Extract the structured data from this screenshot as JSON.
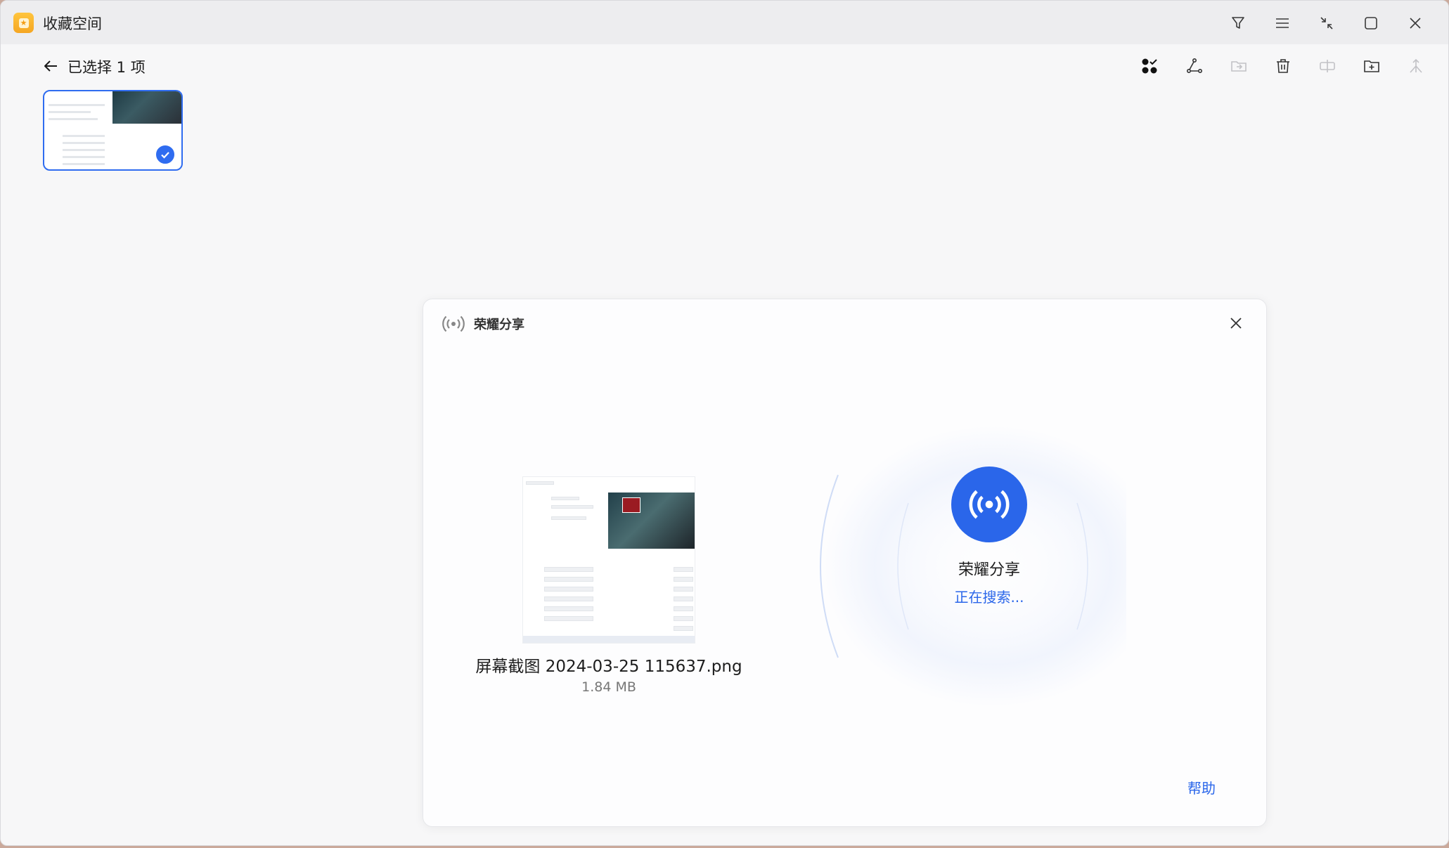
{
  "window": {
    "title": "收藏空间"
  },
  "toolbar": {
    "selection_label": "已选择 1 项"
  },
  "dialog": {
    "title": "荣耀分享",
    "file_name": "屏幕截图 2024-03-25 115637.png",
    "file_size": "1.84 MB",
    "share_label": "荣耀分享",
    "status": "正在搜索...",
    "help_label": "帮助"
  },
  "colors": {
    "accent": "#2a66ea",
    "app_icon": "#f5a623"
  },
  "icons": {
    "titlebar": [
      "filter-icon",
      "menu-icon",
      "shrink-icon",
      "maximize-icon",
      "close-icon"
    ],
    "actions": [
      "select-all-icon",
      "share-icon",
      "move-to-folder-icon",
      "delete-icon",
      "split-icon",
      "new-folder-icon",
      "sort-icon"
    ]
  }
}
